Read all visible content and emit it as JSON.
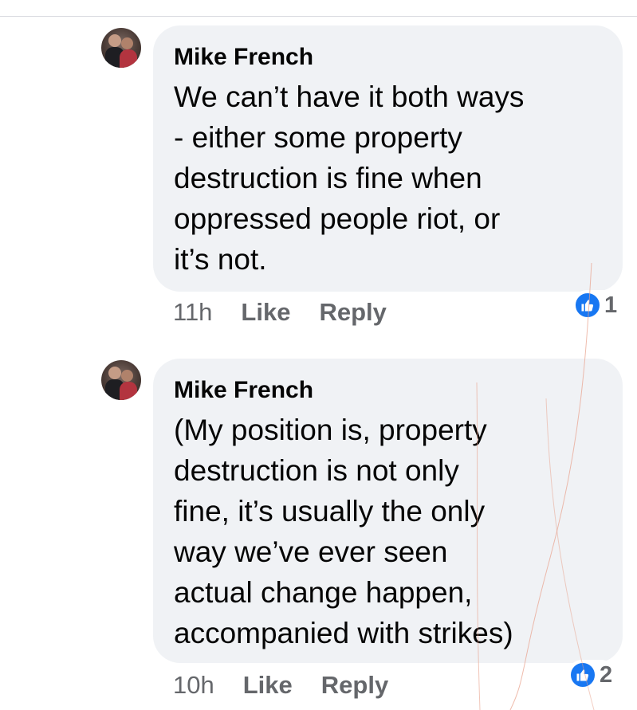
{
  "comments": [
    {
      "author": "Mike French",
      "lines": [
        "We can’t have it both ways",
        "- either some property",
        "destruction is fine when",
        "oppressed people riot, or",
        "it’s not."
      ],
      "time": "11h",
      "like_label": "Like",
      "reply_label": "Reply",
      "reaction_count": "1"
    },
    {
      "author": "Mike French",
      "lines": [
        "(My position is, property",
        "destruction is not only",
        "fine, it’s usually the only",
        "way we’ve ever seen",
        "actual change happen,",
        "accompanied with strikes)"
      ],
      "time": "10h",
      "like_label": "Like",
      "reply_label": "Reply",
      "reaction_count": "2"
    }
  ],
  "icons": {
    "reaction": "thumbs-up-icon",
    "avatar": "avatar"
  },
  "colors": {
    "bubble_bg": "#f0f2f5",
    "meta_text": "#65676b",
    "like_blue": "#1877f2",
    "text": "#050505"
  }
}
